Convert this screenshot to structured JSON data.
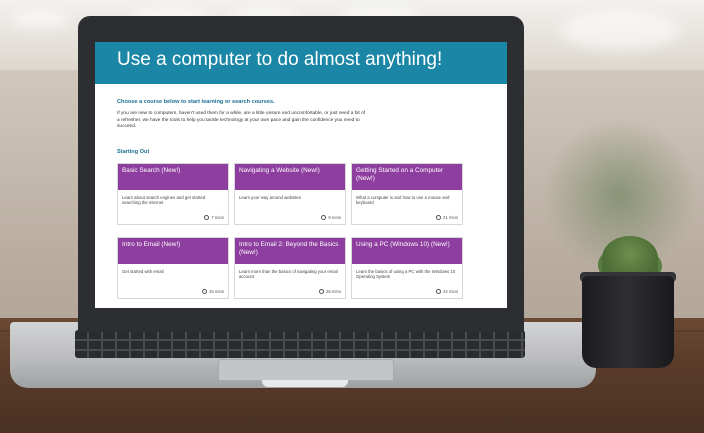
{
  "banner": {
    "title": "Use a computer to do almost anything!"
  },
  "intro": {
    "subheading": "Choose a course below to start learning or search courses.",
    "paragraph": "If you are new to computers, haven't used them for a while, are a little unsure and uncomfortable, or just need a bit of a refresher, we have the tools to help you tackle technology at your own pace and gain the confidence you need to succeed."
  },
  "section": {
    "title": "Starting Out"
  },
  "courses": [
    {
      "title": "Basic Search (New!)",
      "description": "Learn about search engines and get started searching the internet",
      "duration": "7 mins"
    },
    {
      "title": "Navigating a Website (New!)",
      "description": "Learn your way around websites",
      "duration": "8 mins"
    },
    {
      "title": "Getting Started on a Computer (New!)",
      "description": "What a computer is and how to use a mouse and keyboard",
      "duration": "21 mins"
    },
    {
      "title": "Intro to Email (New!)",
      "description": "Get started with email",
      "duration": "15 mins"
    },
    {
      "title": "Intro to Email 2: Beyond the Basics (New!)",
      "description": "Learn more than the basics of navigating your email account",
      "duration": "26 mins"
    },
    {
      "title": "Using a PC (Windows 10) (New!)",
      "description": "Learn the basics of using a PC with the Windows 10 Operating System",
      "duration": "22 mins"
    }
  ],
  "colors": {
    "banner": "#1b86a6",
    "card_header": "#8e3e9f",
    "section_text": "#1b6f93"
  }
}
